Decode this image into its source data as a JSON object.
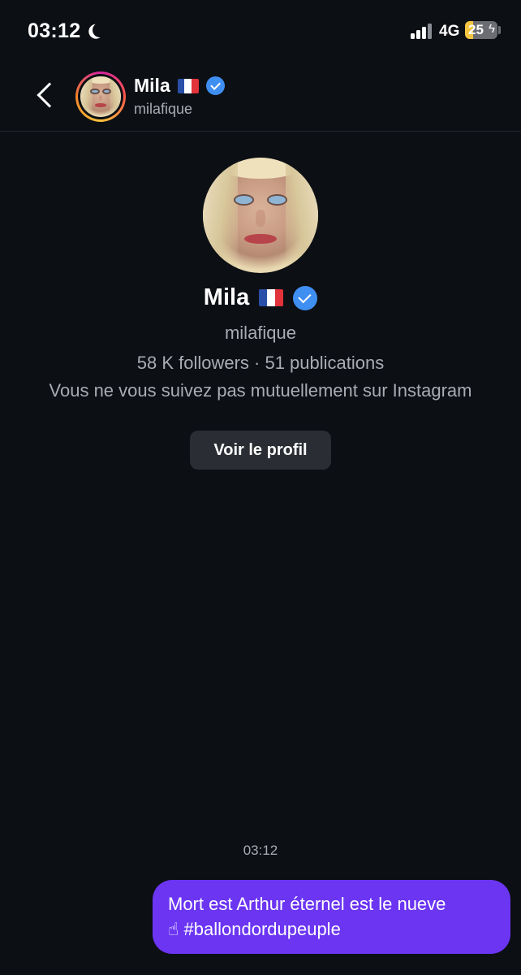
{
  "status_bar": {
    "time": "03:12",
    "network": "4G",
    "battery_level": "25",
    "battery_fraction": 0.25,
    "focus_icon": "moon-icon",
    "signal_icon": "signal-icon",
    "charging_icon": "bolt-icon"
  },
  "header": {
    "back_icon": "chevron-left-icon",
    "name": "Mila",
    "flag": "🇫🇷",
    "username": "milafique",
    "verified": true
  },
  "profile": {
    "name": "Mila",
    "flag": "🇫🇷",
    "username": "milafique",
    "stats": "58 K followers · 51 publications",
    "mutual_text": "Vous ne vous suivez pas mutuellement sur Instagram",
    "view_profile_label": "Voir le profil"
  },
  "conversation": {
    "timestamp": "03:12",
    "messages": [
      {
        "line1": "Mort est Arthur éternel est le nueve",
        "emoji": "☝",
        "line2": " #ballondordupeuple"
      }
    ]
  },
  "colors": {
    "background": "#0c0f14",
    "bubble": "#6b35f2",
    "verified": "#3f8ff2",
    "secondary_text": "#a9acb2",
    "button": "#2a2d33"
  }
}
